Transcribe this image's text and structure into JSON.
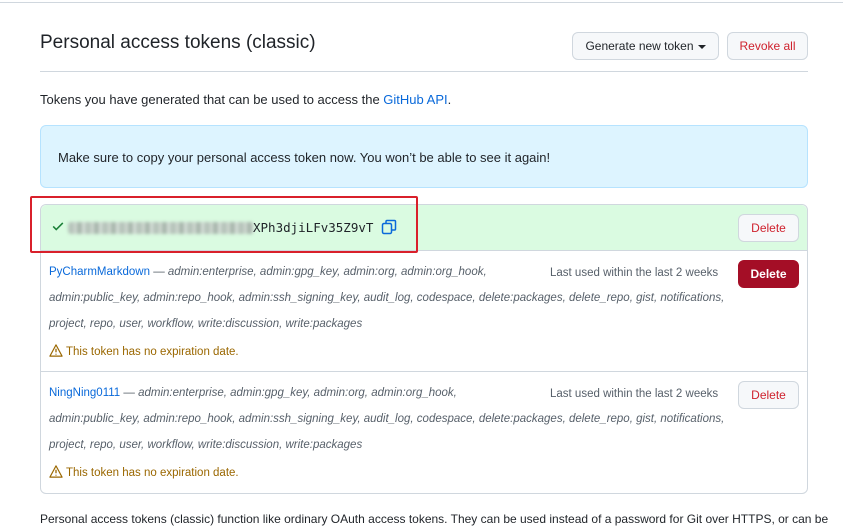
{
  "header": {
    "title": "Personal access tokens (classic)",
    "generate_label": "Generate new token",
    "revoke_label": "Revoke all"
  },
  "intro": {
    "text": "Tokens you have generated that can be used to access the ",
    "link": "GitHub API",
    "suffix": "."
  },
  "flash": {
    "message": "Make sure to copy your personal access token now. You won’t be able to see it again!"
  },
  "new_token": {
    "visible_suffix": "XPh3djiLFv35Z9vT",
    "delete_label": "Delete"
  },
  "tokens": [
    {
      "name": "PyCharmMarkdown",
      "scopes_line1": "admin:enterprise, admin:gpg_key, admin:org, admin:org_hook,",
      "scopes_line2": "admin:public_key, admin:repo_hook, admin:ssh_signing_key, audit_log, codespace, delete:packages, delete_repo, gist, notifications,",
      "scopes_line3": "project, repo, user, workflow, write:discussion, write:packages",
      "last_used": "Last used within the last 2 weeks",
      "warning": "This token has no expiration date.",
      "delete_label": "Delete"
    },
    {
      "name": "NingNing0111",
      "scopes_line1": "admin:enterprise, admin:gpg_key, admin:org, admin:org_hook,",
      "scopes_line2": "admin:public_key, admin:repo_hook, admin:ssh_signing_key, audit_log, codespace, delete:packages, delete_repo, gist, notifications,",
      "scopes_line3": "project, repo, user, workflow, write:discussion, write:packages",
      "last_used": "Last used within the last 2 weeks",
      "warning": "This token has no expiration date.",
      "delete_label": "Delete"
    }
  ],
  "dash": "—",
  "footer": {
    "text": "Personal access tokens (classic) function like ordinary OAuth access tokens. They can be used instead of a password for Git over HTTPS, or can be"
  },
  "colors": {
    "accent": "#0969da",
    "danger": "#a40e26",
    "flash_bg": "#ddf4ff",
    "success_bg": "#dafbe1",
    "highlight": "#d9202b"
  },
  "icons": [
    "check-icon",
    "copy-icon",
    "alert-icon",
    "caret-down-icon"
  ]
}
